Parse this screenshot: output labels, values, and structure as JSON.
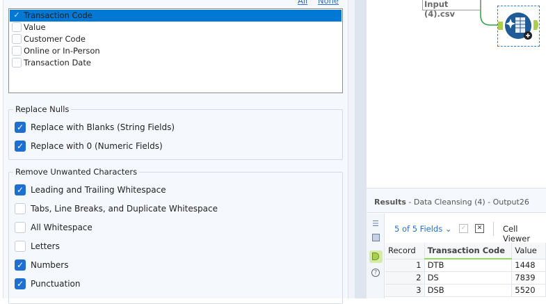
{
  "links": {
    "all": "All",
    "none": "None"
  },
  "fields": [
    {
      "label": "Transaction Code",
      "checked": true,
      "selected": true
    },
    {
      "label": "Value",
      "checked": false
    },
    {
      "label": "Customer Code",
      "checked": false
    },
    {
      "label": "Online or In-Person",
      "checked": false
    },
    {
      "label": "Transaction Date",
      "checked": false
    }
  ],
  "replace_nulls": {
    "title": "Replace Nulls",
    "options": [
      {
        "label": "Replace with Blanks (String Fields)",
        "checked": true
      },
      {
        "label": "Replace with 0 (Numeric Fields)",
        "checked": true
      }
    ]
  },
  "remove_chars": {
    "title": "Remove Unwanted Characters",
    "options": [
      {
        "label": "Leading and Trailing Whitespace",
        "checked": true
      },
      {
        "label": "Tabs, Line Breaks, and Duplicate Whitespace",
        "checked": false
      },
      {
        "label": "All Whitespace",
        "checked": false
      },
      {
        "label": "Letters",
        "checked": false
      },
      {
        "label": "Numbers",
        "checked": true
      },
      {
        "label": "Punctuation",
        "checked": true
      }
    ]
  },
  "canvas": {
    "input_node": "Input (4).csv"
  },
  "results": {
    "title": "Results",
    "subtitle": " - Data Cleansing (4) - Output26",
    "fields_label": "5 of 5 Fields",
    "cell_viewer": "Cell Viewer",
    "columns": [
      "Record",
      "Transaction Code",
      "Value"
    ],
    "rows": [
      [
        "1",
        "DTB",
        "1448"
      ],
      [
        "2",
        "DS",
        "7839"
      ],
      [
        "3",
        "DSB",
        "5520"
      ]
    ]
  },
  "colors": {
    "accent": "#0078d4",
    "checkbox": "#1e6fd0",
    "connector": "#a8d04e"
  }
}
